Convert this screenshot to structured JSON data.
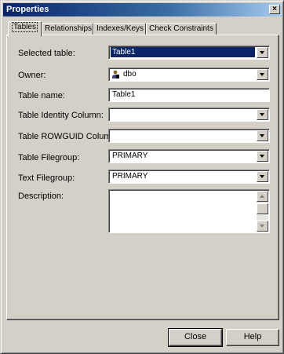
{
  "window": {
    "title": "Properties",
    "close_glyph": "×"
  },
  "tabs": [
    {
      "label": "Tables"
    },
    {
      "label": "Relationships"
    },
    {
      "label": "Indexes/Keys"
    },
    {
      "label": "Check Constraints"
    }
  ],
  "form": {
    "selected_table": {
      "label": "Selected table:",
      "value": "Table1"
    },
    "owner": {
      "label": "Owner:",
      "value": "dbo",
      "icon": "user-icon"
    },
    "table_name": {
      "label": "Table name:",
      "value": "Table1"
    },
    "identity_column": {
      "label": "Table Identity Column:",
      "value": ""
    },
    "rowguid_column": {
      "label": "Table ROWGUID Column:",
      "value": ""
    },
    "filegroup": {
      "label": "Table Filegroup:",
      "value": "PRIMARY"
    },
    "text_filegroup": {
      "label": "Text Filegroup:",
      "value": "PRIMARY"
    },
    "description": {
      "label": "Description:",
      "value": ""
    }
  },
  "buttons": {
    "close": "Close",
    "help": "Help"
  },
  "colors": {
    "title_bar": "#0a246a",
    "selection": "#0a246a",
    "face": "#d4d0c8"
  }
}
